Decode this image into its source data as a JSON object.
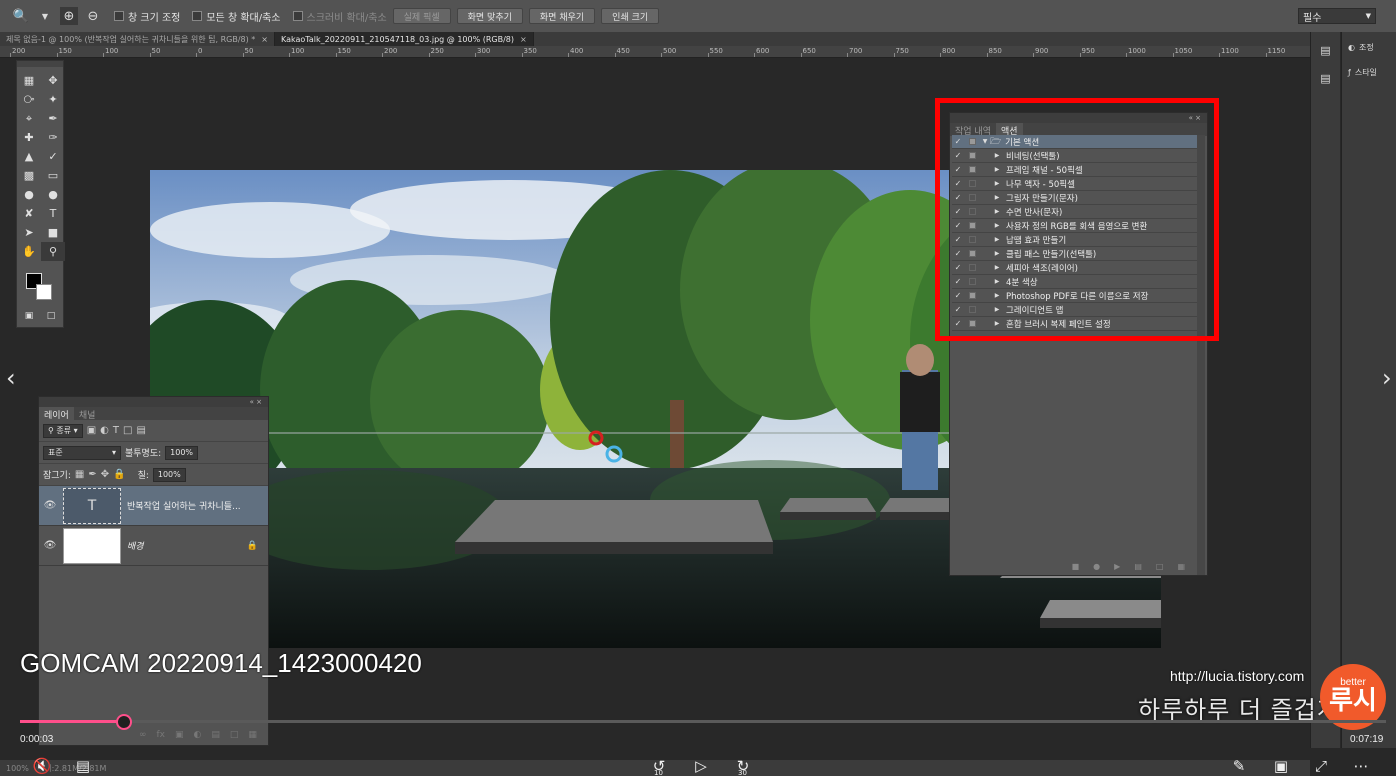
{
  "optionbar": {
    "checkbox_resize": "창 크기 조정",
    "checkbox_all_windows": "모든 창 확대/축소",
    "checkbox_scrubby": "스크러비 확대/축소",
    "btn_actual": "실제 픽셀",
    "btn_fit": "화면 맞추기",
    "btn_fill": "화면 채우기",
    "btn_print": "인쇄 크기",
    "workspace": "필수"
  },
  "tabs": [
    {
      "label": "제목 없음-1 @ 100% (반복작업 실어하는 귀차니들을 위한 팁, RGB/8) *"
    },
    {
      "label": "KakaoTalk_20220911_210547118_03.jpg @ 100% (RGB/8)"
    }
  ],
  "ruler": [
    "200",
    "150",
    "100",
    "50",
    "0",
    "50",
    "100",
    "150",
    "200",
    "250",
    "300",
    "350",
    "400",
    "450",
    "500",
    "550",
    "600",
    "650",
    "700",
    "750",
    "800",
    "850",
    "900",
    "950",
    "1000",
    "1050",
    "1100",
    "1150",
    "1200"
  ],
  "layers": {
    "tabs": [
      "레이어",
      "채널"
    ],
    "filter_kind": "종류",
    "blend_mode": "표준",
    "opacity_label": "불투명도:",
    "opacity_value": "100%",
    "lock_label": "잠그기:",
    "fill_label": "칠:",
    "fill_value": "100%",
    "items": [
      {
        "name": "반복작업 실어하는 귀차니들...",
        "thumb": "T"
      },
      {
        "name": "배경"
      }
    ]
  },
  "actions_panel": {
    "tabs": [
      "작업 내역",
      "액션"
    ],
    "folder": "기본 액션",
    "items": [
      {
        "label": "비네팅(선택툴)",
        "dialog": true
      },
      {
        "label": "프레임 채널 - 50픽셀",
        "dialog": true
      },
      {
        "label": "나무 액자 - 50픽셀",
        "dialog": false
      },
      {
        "label": "그림자 만들기(문자)",
        "dialog": false
      },
      {
        "label": "수면 반사(문자)",
        "dialog": false
      },
      {
        "label": "사용자 정의 RGB를 회색 음영으로 변환",
        "dialog": true
      },
      {
        "label": "납땜 효과 만들기",
        "dialog": false
      },
      {
        "label": "클립 패스 만들기(선택툴)",
        "dialog": true
      },
      {
        "label": "세피아 색조(레이어)",
        "dialog": false
      },
      {
        "label": "4분 색상",
        "dialog": false
      },
      {
        "label": "Photoshop PDF로 다른 이름으로 저장",
        "dialog": true
      },
      {
        "label": "그레이디언트 맵",
        "dialog": false
      },
      {
        "label": "혼합 브러시 복제 페인트 설정",
        "dialog": true
      }
    ]
  },
  "dock": {
    "adjust": "조정",
    "styles": "스타일"
  },
  "player": {
    "title": "GOMCAM 20220914_1423000420",
    "url": "http://lucia.tistory.com",
    "slogan": "하루하루 더 즐겁게",
    "logo_small": "better",
    "logo_large": "루시",
    "time_current": "0:00:03",
    "time_total": "0:07:19",
    "progress_fraction": 0.0068,
    "skip_back": "10",
    "skip_fwd": "30"
  },
  "statusbar": {
    "zoom": "100%",
    "doc": "문서:2.81M/2.81M"
  },
  "colors": {
    "highlight": "#ff0000",
    "seek": "#ff4f8b",
    "logo": "#f15a2b"
  }
}
